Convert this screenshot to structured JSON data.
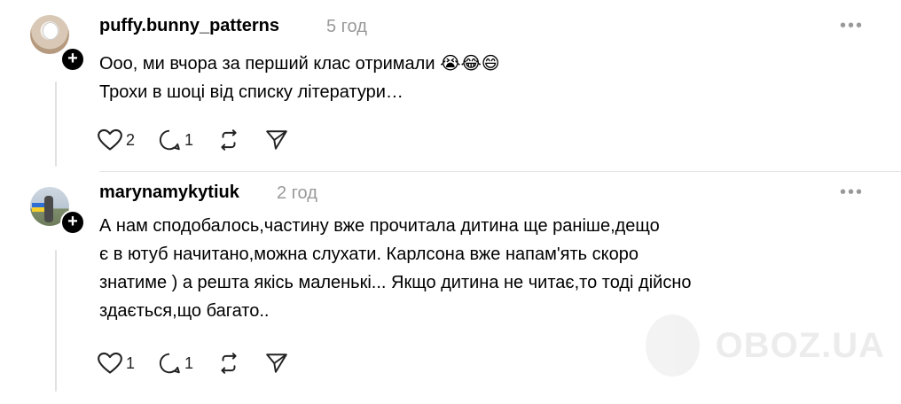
{
  "posts": [
    {
      "username": "puffy.bunny_patterns",
      "time": "5 год",
      "more": "•••",
      "lines": [
        "Ооо, ми вчора за перший клас отримали 😭😂😄",
        "Трохи в шоці від списку літератури…"
      ],
      "likes": "2",
      "replies": "1"
    },
    {
      "username": "marynamykytiuk",
      "time": "2 год",
      "more": "•••",
      "lines": [
        "А нам сподобалось,частину вже прочитала дитина ще раніше,дещо",
        "є в ютуб начитано,можна слухати. Карлсона вже напам'ять скоро",
        "знатиме ) а решта якісь маленькі... Якщо дитина не читає,то тоді дійсно",
        "здається,що багато.."
      ],
      "likes": "1",
      "replies": "1"
    }
  ],
  "icons": {
    "like": "heart-icon",
    "reply": "comment-icon",
    "repost": "repost-icon",
    "share": "send-icon",
    "follow": "plus-icon"
  },
  "watermark": {
    "text": "OBOZ.UA"
  }
}
